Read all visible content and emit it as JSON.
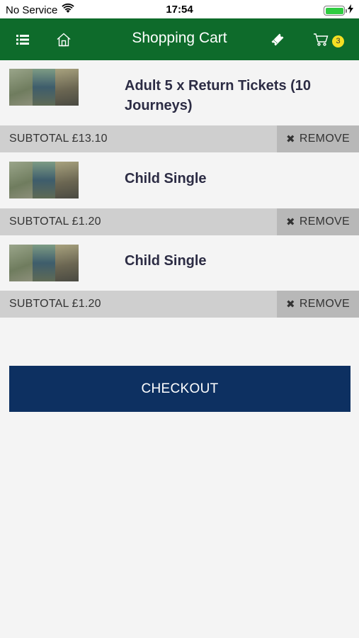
{
  "status_bar": {
    "carrier": "No Service",
    "time": "17:54"
  },
  "nav": {
    "title": "Shopping Cart",
    "cart_count": "3",
    "icons": [
      "list-icon",
      "home-icon",
      "ticket-icon",
      "cart-icon"
    ]
  },
  "items": [
    {
      "title": "Adult 5 x Return Tickets (10 Journeys)",
      "subtotal": "SUBTOTAL £13.10",
      "remove_label": "REMOVE"
    },
    {
      "title": "Child Single",
      "subtotal": "SUBTOTAL £1.20",
      "remove_label": "REMOVE"
    },
    {
      "title": "Child Single",
      "subtotal": "SUBTOTAL £1.20",
      "remove_label": "REMOVE"
    }
  ],
  "checkout_label": "CHECKOUT",
  "colors": {
    "nav_bg": "#0e6b2b",
    "checkout_bg": "#0d3061",
    "badge": "#f5df23",
    "subtotal_bg": "#cfcfcf",
    "remove_bg": "#b8b8b8"
  }
}
